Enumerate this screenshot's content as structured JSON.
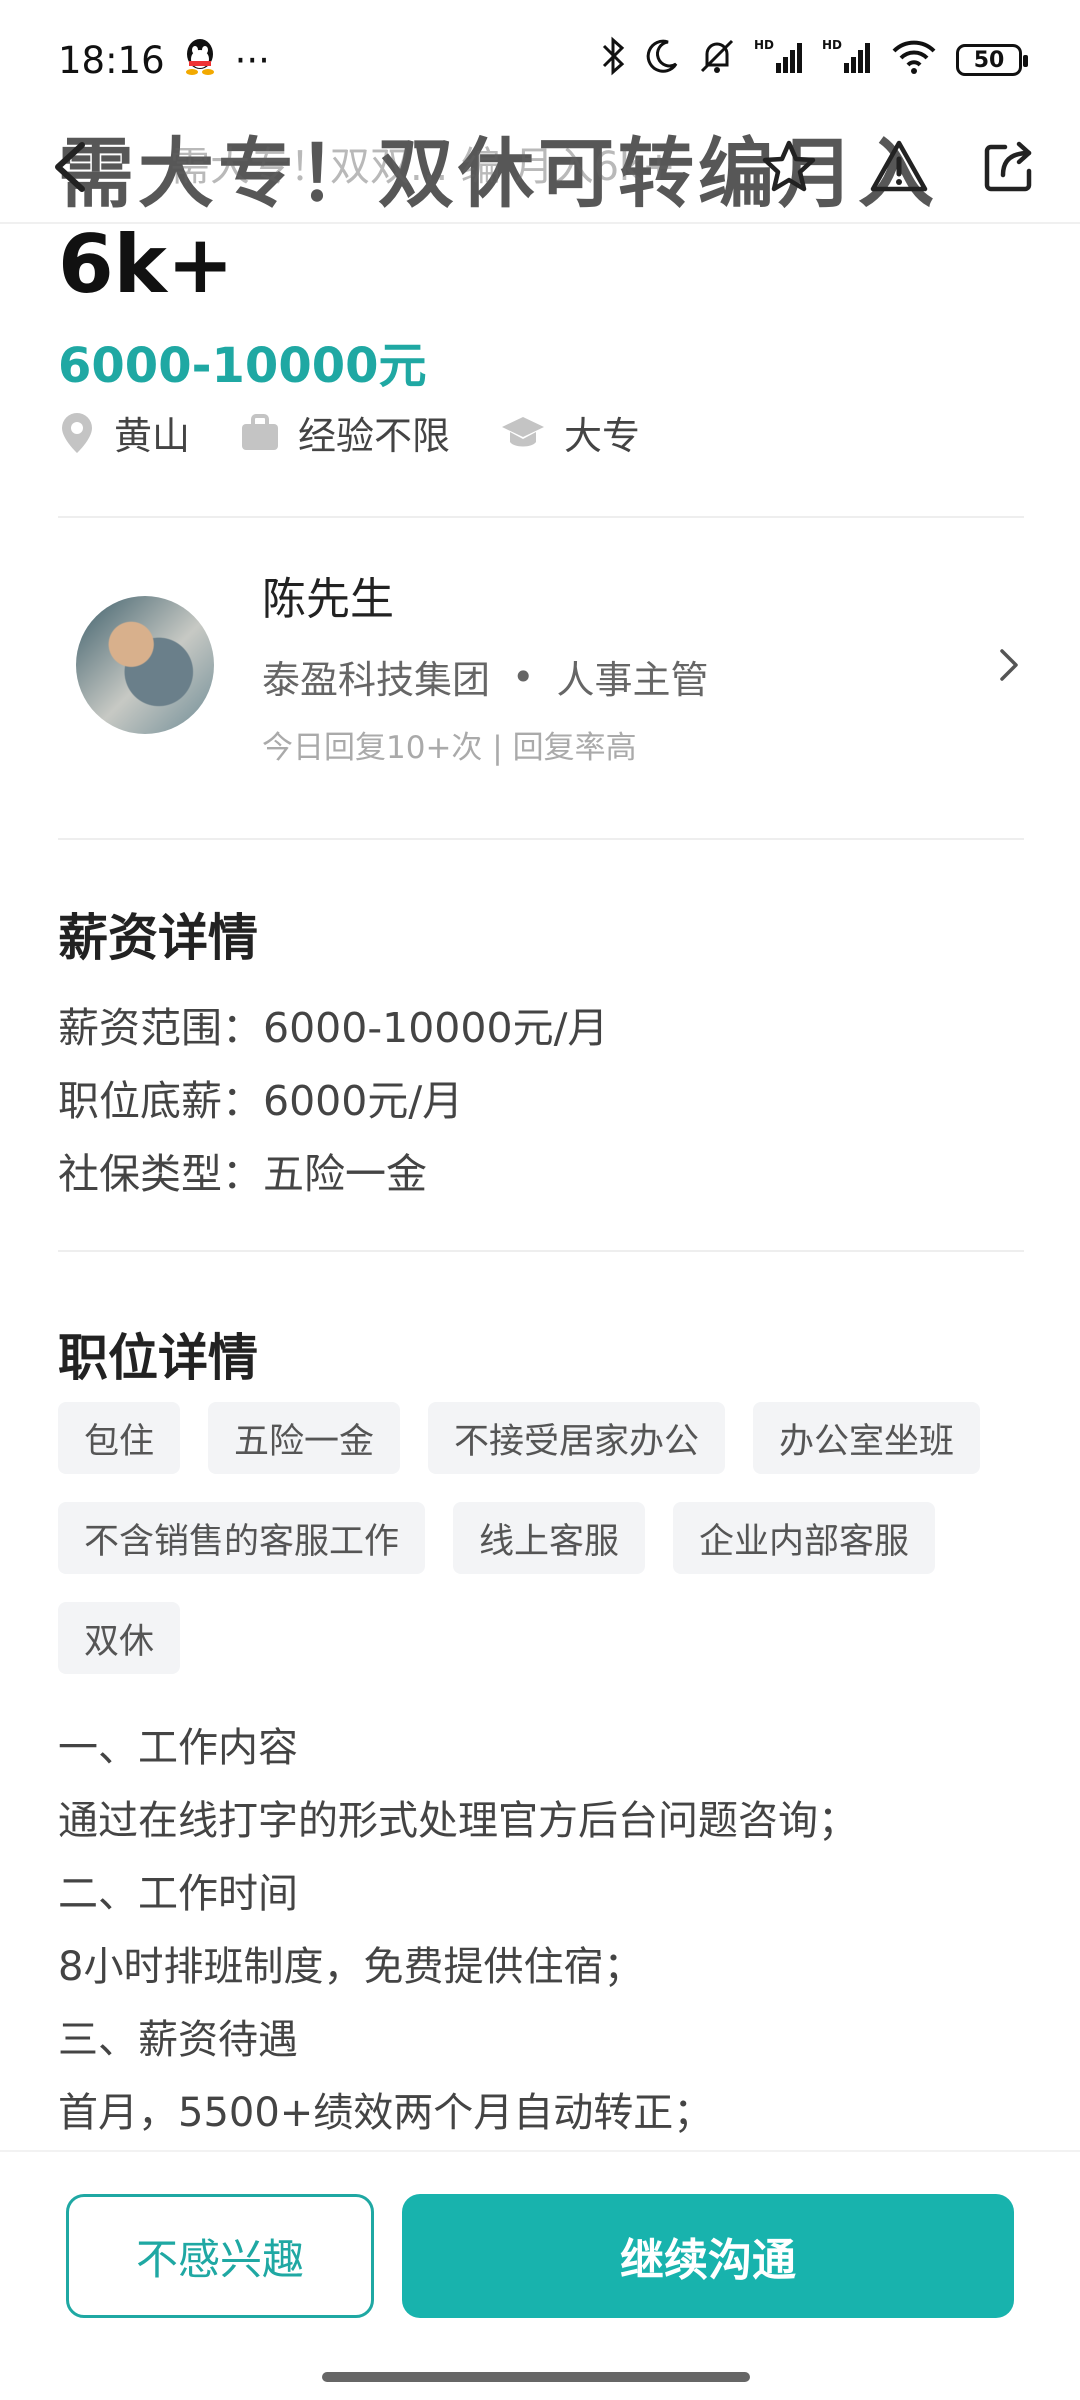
{
  "status_bar": {
    "time": "18:16",
    "more": "···",
    "battery": "50",
    "icons": [
      "qq-icon",
      "bluetooth-icon",
      "moon-icon",
      "bell-off-icon",
      "hd-signal-icon",
      "hd-signal-icon",
      "wifi-icon"
    ]
  },
  "header": {
    "title": "需大专！双休可转编月入",
    "sub_title": "需大专！双双... 编 月入6k+"
  },
  "job": {
    "title_tail": "6k+",
    "salary": "6000-10000元",
    "meta": {
      "location": "黄山",
      "experience": "经验不限",
      "education": "大专"
    }
  },
  "recruiter": {
    "name": "陈先生",
    "company": "泰盈科技集团",
    "separator": "•",
    "role": "人事主管",
    "activity": "今日回复10+次 | 回复率高"
  },
  "salary_details": {
    "heading": "薪资详情",
    "lines": [
      "薪资范围：6000-10000元/月",
      "职位底薪：6000元/月",
      "社保类型：五险一金"
    ]
  },
  "job_details": {
    "heading": "职位详情",
    "tags": [
      "包住",
      "五险一金",
      "不接受居家办公",
      "办公室坐班",
      "不含销售的客服工作",
      "线上客服",
      "企业内部客服",
      "双休"
    ],
    "description": [
      "一、工作内容",
      "通过在线打字的形式处理官方后台问题咨询；",
      "二、工作时间",
      "8小时排班制度，免费提供住宿；",
      "三、薪资待遇",
      "首月，5500+绩效两个月自动转正；"
    ]
  },
  "actions": {
    "not_interested": "不感兴趣",
    "continue_chat": "继续沟通"
  },
  "colors": {
    "accent": "#1fa8a3",
    "primary_button": "#18b3ad"
  }
}
